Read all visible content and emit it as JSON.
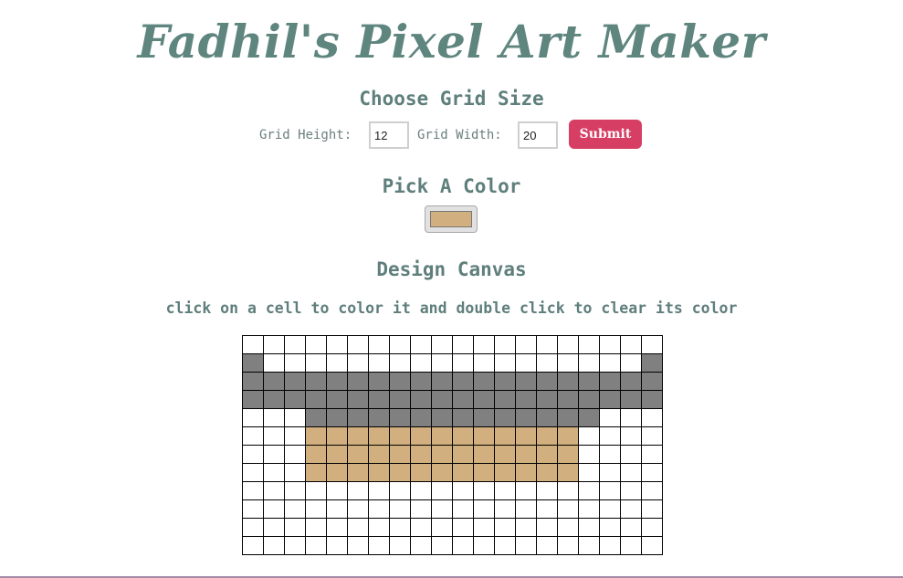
{
  "header": {
    "title": "Fadhil's Pixel Art Maker"
  },
  "grid_size": {
    "heading": "Choose Grid Size",
    "height_label": "Grid Height:",
    "height_value": "12",
    "width_label": "Grid Width:",
    "width_value": "20",
    "submit_label": "Submit"
  },
  "color": {
    "heading": "Pick A Color",
    "selected": "#d2af7e"
  },
  "canvas": {
    "heading": "Design Canvas",
    "instructions": "click on a cell to color it and double click to clear its color",
    "rows": 12,
    "cols": 20,
    "palette": {
      "W": "#ffffff",
      "G": "#808080",
      "T": "#d2af7e"
    },
    "cells": [
      "WWWWWWWWWWWWWWWWWWWW",
      "GWWWWWWWWWWWWWWWWWWG",
      "GGGGGGGGGGGGGGGGGGGG",
      "GGGGGGGGGGGGGGGGGGGG",
      "WWWGGGGGGGGGGGGGGWWW",
      "WWWTTTTTTTTTTTTTWWWW",
      "WWWTTTTTTTTTTTTTWWWW",
      "WWWTTTTTTTTTTTTTWWWW",
      "WWWWWWWWWWWWWWWWWWWW",
      "WWWWWWWWWWWWWWWWWWWW",
      "WWWWWWWWWWWWWWWWWWWW",
      "WWWWWWWWWWWWWWWWWWWW"
    ]
  }
}
